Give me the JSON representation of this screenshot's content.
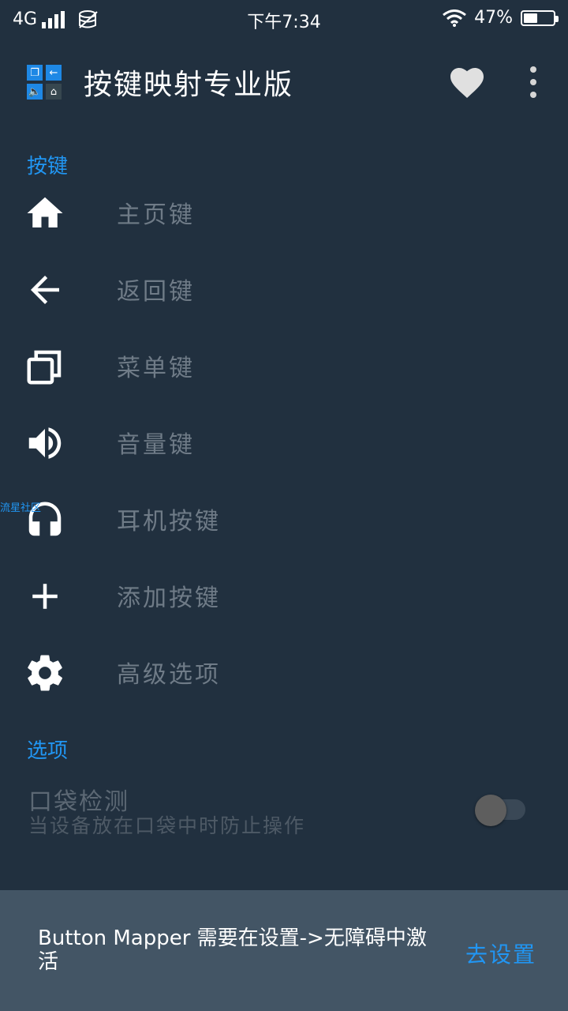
{
  "status_bar": {
    "network": "4G",
    "time": "下午7:34",
    "battery_percent_text": "47%",
    "battery_level": 0.47
  },
  "toolbar": {
    "title": "按键映射专业版",
    "icons": [
      "app-logo-icon",
      "heart-icon",
      "more-vert-icon"
    ]
  },
  "sections": {
    "buttons_header": "按键",
    "options_header": "选项"
  },
  "buttons": [
    {
      "label": "主页键",
      "icon": "home-icon"
    },
    {
      "label": "返回键",
      "icon": "back-arrow-icon"
    },
    {
      "label": "菜单键",
      "icon": "recents-icon"
    },
    {
      "label": "音量键",
      "icon": "volume-icon"
    },
    {
      "label": "耳机按键",
      "icon": "headset-icon"
    },
    {
      "label": "添加按键",
      "icon": "plus-icon"
    },
    {
      "label": "高级选项",
      "icon": "gear-icon"
    }
  ],
  "pocket_detection": {
    "title": "口袋检测",
    "summary": "当设备放在口袋中时防止操作",
    "enabled": false
  },
  "snackbar": {
    "message": "Button Mapper 需要在设置->无障碍中激活",
    "action": "去设置"
  },
  "watermark": "流星社区",
  "colors": {
    "background": "#21303f",
    "accent": "#2196f3",
    "snackbar": "#435565"
  }
}
